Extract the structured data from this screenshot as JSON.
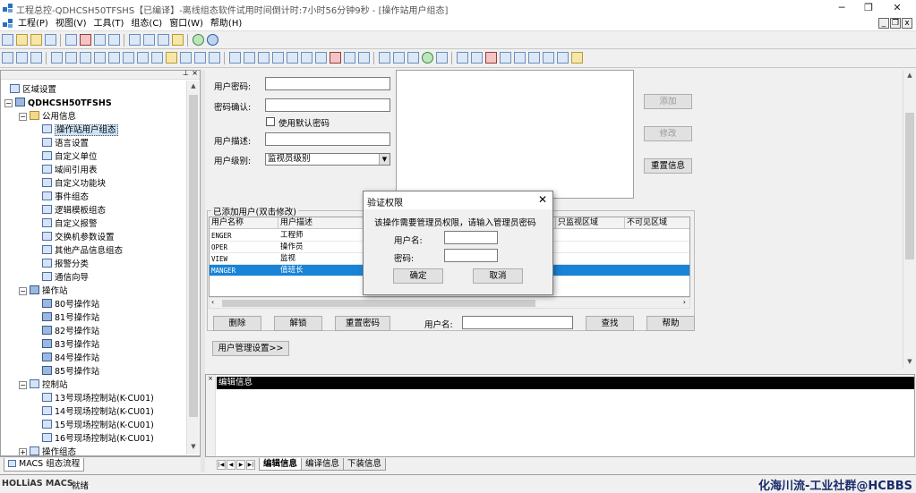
{
  "window": {
    "title": "工程总控-QDHCSH50TFSHS【已编译】-离线组态软件试用时间倒计时:7小时56分钟9秒 - [操作站用户组态]",
    "minimize": "─",
    "maximize": "❐",
    "close": "✕"
  },
  "menu": {
    "items": [
      "工程(P)",
      "视图(V)",
      "工具(T)",
      "组态(C)",
      "窗口(W)",
      "帮助(H)"
    ],
    "mdi_min": "_",
    "mdi_restore": "❐",
    "mdi_close": "x"
  },
  "tree": {
    "root": "区域设置",
    "project": "QDHCSH50TFSHS",
    "public_info": "公用信息",
    "public_items": [
      "操作站用户组态",
      "语言设置",
      "自定义单位",
      "域间引用表",
      "自定义功能块",
      "事件组态",
      "逻辑模板组态",
      "自定义报警",
      "交换机参数设置",
      "其他产品信息组态",
      "报警分类",
      "通信向导"
    ],
    "selected": "操作站用户组态",
    "operator_stations": "操作站",
    "stations": [
      "80号操作站",
      "81号操作站",
      "82号操作站",
      "83号操作站",
      "84号操作站",
      "85号操作站"
    ],
    "control_stations": "控制站",
    "controllers": [
      "13号现场控制站(K-CU01)",
      "14号现场控制站(K-CU01)",
      "15号现场控制站(K-CU01)",
      "16号现场控制站(K-CU01)"
    ],
    "more": "操作组态"
  },
  "left_tab": "MACS 组态流程",
  "form": {
    "password_label": "用户密码:",
    "confirm_label": "密码确认:",
    "default_pwd_label": "使用默认密码",
    "desc_label": "用户描述:",
    "level_label": "用户级别:",
    "level_value": "监视员级别",
    "add_btn": "添加",
    "modify_btn": "修改",
    "reset_info_btn": "重置信息"
  },
  "users": {
    "group_label": "已添加用户(双击修改)",
    "columns": [
      "用户名称",
      "用户描述",
      "只监视区域",
      "不可见区域"
    ],
    "rows": [
      {
        "name": "ENGER",
        "desc": "工程师"
      },
      {
        "name": "OPER",
        "desc": "操作员"
      },
      {
        "name": "VIEW",
        "desc": "监视"
      },
      {
        "name": "MANGER",
        "desc": "值班长"
      }
    ],
    "selected_index": 3
  },
  "actions": {
    "delete": "删除",
    "unlock": "解锁",
    "reset_pwd": "重置密码",
    "username_label": "用户名:",
    "find": "查找",
    "help": "帮助",
    "manage": "用户管理设置>>"
  },
  "output": {
    "header": "编辑信息",
    "tabs": [
      "编辑信息",
      "编译信息",
      "下装信息"
    ],
    "active_tab": 0
  },
  "status": {
    "brand": "HOLLiAS MACS",
    "state": "就绪",
    "watermark": "化海川流-工业社群@HCBBS"
  },
  "dialog": {
    "title": "验证权限",
    "close": "✕",
    "prompt": "该操作需要管理员权限，请输入管理员密码",
    "username_label": "用户名:",
    "password_label": "密码:",
    "ok": "确定",
    "cancel": "取消"
  }
}
